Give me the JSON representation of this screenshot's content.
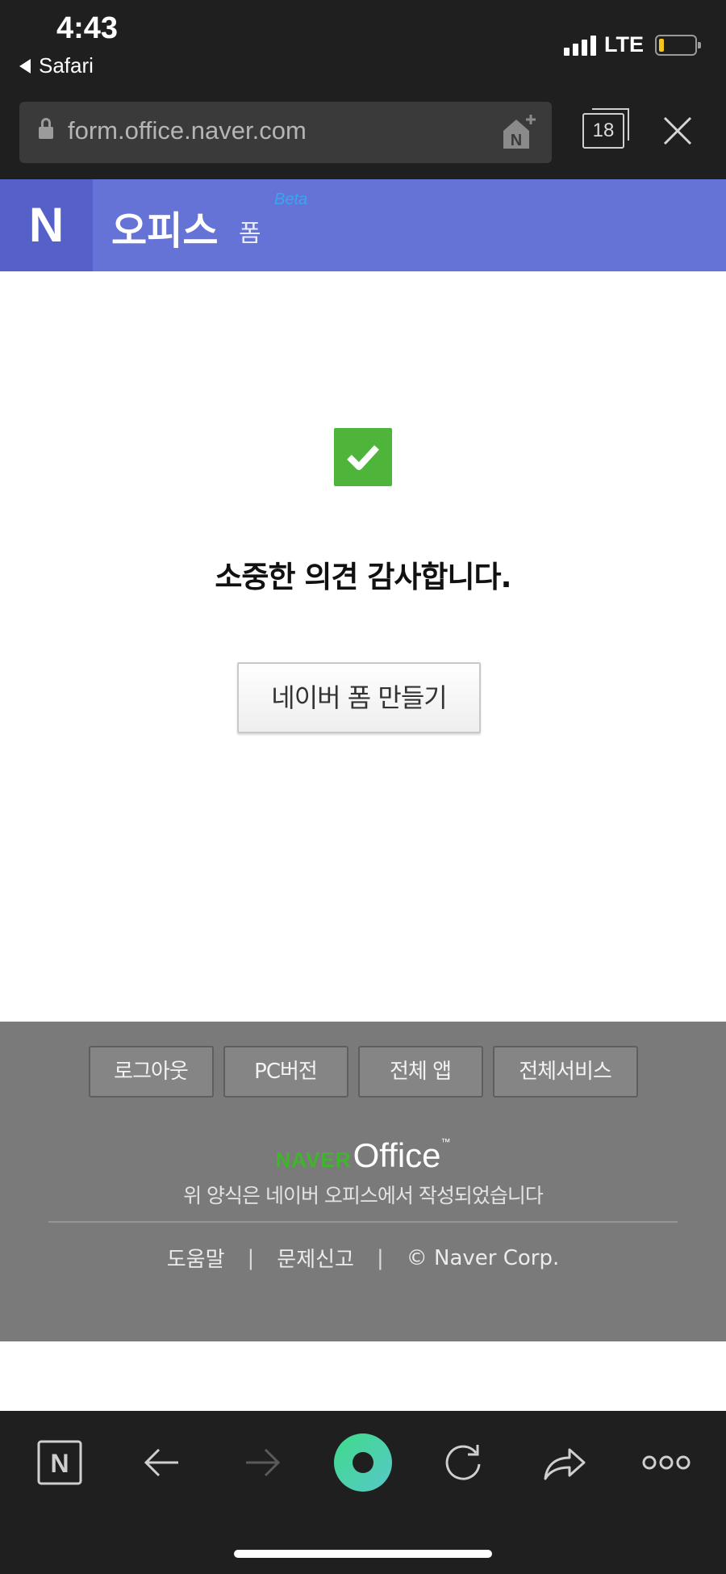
{
  "status_bar": {
    "time": "4:43",
    "back_app": "Safari",
    "network": "LTE",
    "signal_bars": 4,
    "battery_level": 0.1
  },
  "browser": {
    "url": "form.office.naver.com",
    "tab_count": "18"
  },
  "header": {
    "logo": "N",
    "title": "오피스",
    "subtitle": "폼",
    "badge": "Beta"
  },
  "main": {
    "message": "소중한 의견 감사합니다.",
    "create_button": "네이버 폼 만들기"
  },
  "footer": {
    "buttons": [
      "로그아웃",
      "PC버전",
      "전체 앱",
      "전체서비스"
    ],
    "brand_naver": "NAVER",
    "brand_office": "Office",
    "brand_tm": "™",
    "note": "위 양식은 네이버 오피스에서 작성되었습니다",
    "links": [
      "도움말",
      "문제신고",
      "© Naver Corp."
    ],
    "separator": "|"
  },
  "toolbar": {
    "items": [
      "naver-home",
      "back",
      "forward",
      "green-dot",
      "reload",
      "share",
      "more"
    ]
  },
  "colors": {
    "header_bg": "#6673d6",
    "logo_bg": "#5560c8",
    "check_green": "#4fb43a",
    "footer_bg": "#7a7a7a",
    "naver_green": "#3fb52b",
    "dark_bar": "#1f1f1f"
  }
}
